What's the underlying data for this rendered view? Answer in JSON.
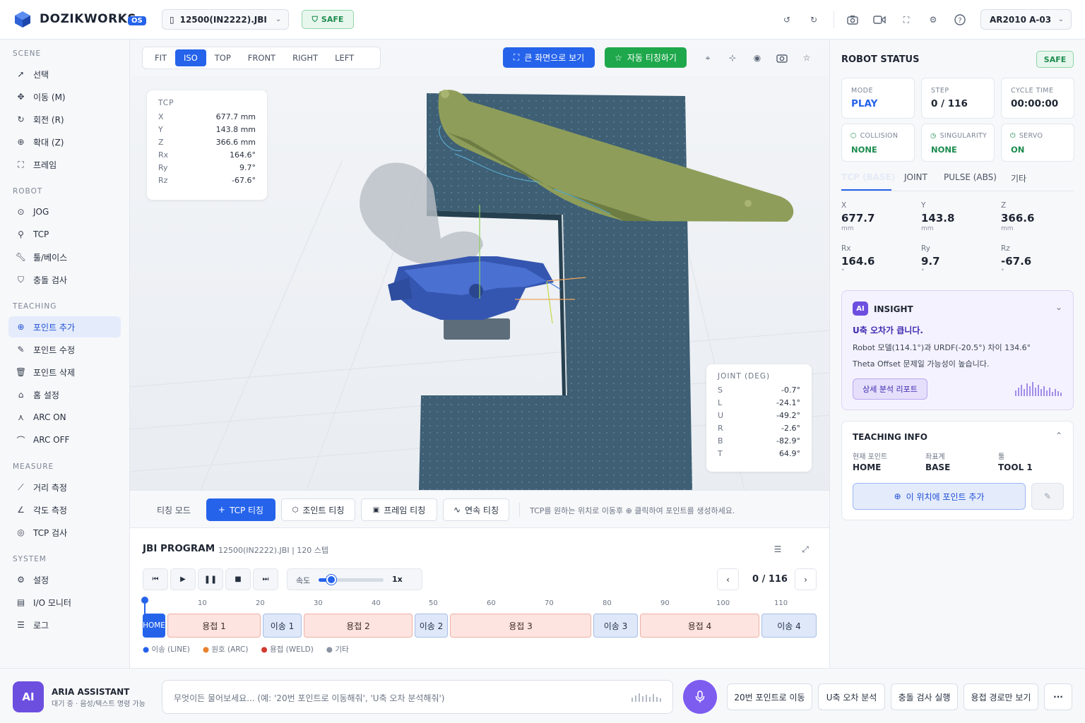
{
  "header": {
    "brand": "DOZIKWORKS",
    "version": "OS",
    "file": "12500(IN2222).JBI",
    "safe": "SAFE",
    "robot": "AR2010 A-03"
  },
  "sidebar": {
    "scene_title": "SCENE",
    "scene": [
      "선택",
      "이동 (M)",
      "회전 (R)",
      "확대 (Z)",
      "프레임"
    ],
    "robot_title": "ROBOT",
    "robot": [
      "JOG",
      "TCP",
      "툴/베이스",
      "충돌 검사"
    ],
    "teaching_title": "TEACHING",
    "teaching": [
      "포인트 추가",
      "포인트 수정",
      "포인트 삭제",
      "홈 설정",
      "ARC ON",
      "ARC OFF"
    ],
    "measure_title": "MEASURE",
    "measure": [
      "거리 측정",
      "각도 측정",
      "TCP 검사"
    ],
    "system_title": "SYSTEM",
    "system": [
      "설정",
      "I/O 모니터",
      "로그"
    ]
  },
  "view": {
    "tabs": [
      "FIT",
      "ISO",
      "TOP",
      "FRONT",
      "RIGHT",
      "LEFT"
    ],
    "fullscreen": "큰 화면으로 보기",
    "auto_teach": "자동 티칭하기"
  },
  "tcp_card": {
    "title": "TCP",
    "rows": [
      {
        "k": "X",
        "v": "677.7 mm"
      },
      {
        "k": "Y",
        "v": "143.8 mm"
      },
      {
        "k": "Z",
        "v": "366.6 mm"
      },
      {
        "k": "Rx",
        "v": "164.6°"
      },
      {
        "k": "Ry",
        "v": "9.7°"
      },
      {
        "k": "Rz",
        "v": "-67.6°"
      }
    ]
  },
  "joint_card": {
    "title": "JOINT (DEG)",
    "rows": [
      {
        "k": "S",
        "v": "-0.7°"
      },
      {
        "k": "L",
        "v": "-24.1°"
      },
      {
        "k": "U",
        "v": "-49.2°"
      },
      {
        "k": "R",
        "v": "-2.6°"
      },
      {
        "k": "B",
        "v": "-82.9°"
      },
      {
        "k": "T",
        "v": "64.9°"
      }
    ]
  },
  "teach_bar": {
    "mode": "티칭 모드",
    "tcp": "TCP 티칭",
    "joint": "조인트 티칭",
    "frame": "프레임 티칭",
    "continuous": "연속 티칭",
    "hint": "TCP를 원하는 위치로 이동후 ⊕ 클릭하여 포인트를 생성하세요."
  },
  "jbi": {
    "title": "JBI PROGRAM",
    "meta": "12500(IN2222).JBI | 120 스텝",
    "speed_label": "속도",
    "speed_value": "1x",
    "speed_fraction": 0.2,
    "step": "0 / 116",
    "ticks": [
      "10",
      "20",
      "30",
      "40",
      "50",
      "60",
      "70",
      "80",
      "90",
      "100",
      "110"
    ],
    "segments": [
      "HOME",
      "용접 1",
      "이송 1",
      "용접 2",
      "이송 2",
      "용접 3",
      "이송 3",
      "용접 4",
      "이송 4"
    ],
    "legend": [
      "이송 (LINE)",
      "원호 (ARC)",
      "용접 (WELD)",
      "기타"
    ]
  },
  "status": {
    "title": "ROBOT STATUS",
    "safe": "SAFE",
    "mode_k": "MODE",
    "mode_v": "PLAY",
    "step_k": "STEP",
    "step_v": "0 / 116",
    "cycle_k": "CYCLE TIME",
    "cycle_v": "00:00:00",
    "collision_k": "COLLISION",
    "collision_v": "NONE",
    "singularity_k": "SINGULARITY",
    "singularity_v": "NONE",
    "servo_k": "SERVO",
    "servo_v": "ON",
    "tabs": [
      "TCP (BASE)",
      "JOINT",
      "PULSE (ABS)",
      "기타"
    ],
    "coords": [
      {
        "k": "X",
        "v": "677.7",
        "u": "mm"
      },
      {
        "k": "Y",
        "v": "143.8",
        "u": "mm"
      },
      {
        "k": "Z",
        "v": "366.6",
        "u": "mm"
      },
      {
        "k": "Rx",
        "v": "164.6",
        "u": "°"
      },
      {
        "k": "Ry",
        "v": "9.7",
        "u": "°"
      },
      {
        "k": "Rz",
        "v": "-67.6",
        "u": "°"
      }
    ]
  },
  "insight": {
    "badge": "AI",
    "title": "INSIGHT",
    "headline": "U축 오차가 큽니다.",
    "line1": "Robot 모델(114.1°)과 URDF(-20.5°) 차이 134.6°",
    "line2": "Theta Offset 문제일 가능성이 높습니다.",
    "button": "상세 분석 리포트"
  },
  "teaching_info": {
    "title": "TEACHING INFO",
    "k1": "현재 포인트",
    "v1": "HOME",
    "k2": "좌표계",
    "v2": "BASE",
    "k3": "툴",
    "v3": "TOOL 1",
    "add": "이 위치에 포인트 추가"
  },
  "assistant": {
    "badge": "AI",
    "name": "ARIA ASSISTANT",
    "status": "대기 중 · 음성/텍스트 명령 가능",
    "placeholder": "무엇이든 물어보세요... (예: '20번 포인트로 이동해줘', 'U축 오차 분석해줘')",
    "quick": [
      "20번 포인트로 이동",
      "U축 오차 분석",
      "충돌 검사 실행",
      "용접 경로만 보기"
    ],
    "more": "···"
  },
  "colors": {
    "accent": "#2563eb",
    "green": "#1ea84b",
    "safe": "#1b8c4e",
    "weld": "#fde4e0",
    "move": "#dfe8f9"
  }
}
